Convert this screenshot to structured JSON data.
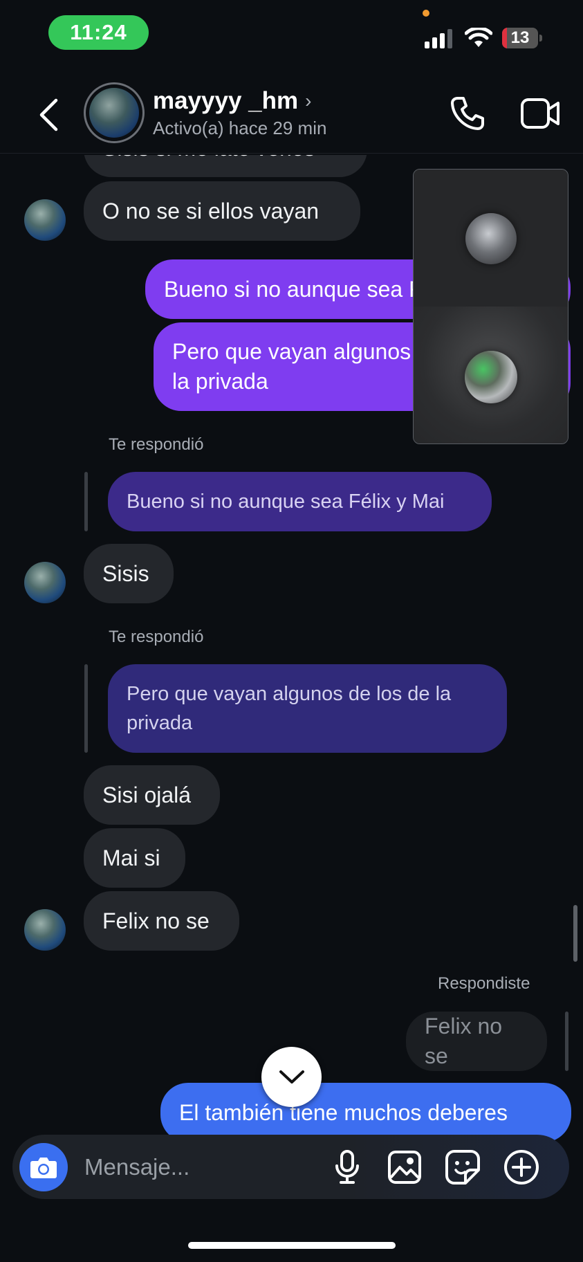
{
  "status_bar": {
    "time": "11:24",
    "battery": "13",
    "battery_level": 0.13
  },
  "header": {
    "username": "mayyyy _hm",
    "chevron": "›",
    "activity": "Activo(a) hace 29 min"
  },
  "messages": {
    "m0_partial": "Sisis si me late verlos",
    "m1": "O no se si ellos vayan",
    "m2": "Bueno si no aunque sea Félix y Mai",
    "m3_line1": "Pero que vayan algunos de los de",
    "m3_line2": "la privada",
    "reply1_label": "Te respondió",
    "reply1_quote": "Bueno si no aunque sea Félix y Mai",
    "m4": "Sisis",
    "reply2_label": "Te respondió",
    "reply2_quote_line1": "Pero que vayan algunos de los de la",
    "reply2_quote_line2": "privada",
    "m5": "Sisi ojalá",
    "m6": "Mai si",
    "m7": "Felix no se",
    "reply3_label": "Respondiste",
    "reply3_quote": "Felix no se",
    "m8": "El también tiene muchos deberes"
  },
  "composer": {
    "placeholder": "Mensaje..."
  },
  "icons": {
    "back": "back-chevron-icon",
    "call": "phone-icon",
    "video": "video-camera-icon",
    "camera": "camera-icon",
    "mic": "microphone-icon",
    "gallery": "gallery-icon",
    "sticker": "sticker-icon",
    "plus": "plus-circle-icon",
    "jump": "chevron-down-icon"
  },
  "colors": {
    "background": "#0b0e12",
    "incoming_bubble": "#24272c",
    "outgoing_bubble": "#7f3df0",
    "outgoing_blue": "#3d6ef0",
    "status_time_pill": "#34c759",
    "battery_low": "#e0313f",
    "camera_button": "#3a6ff0"
  }
}
